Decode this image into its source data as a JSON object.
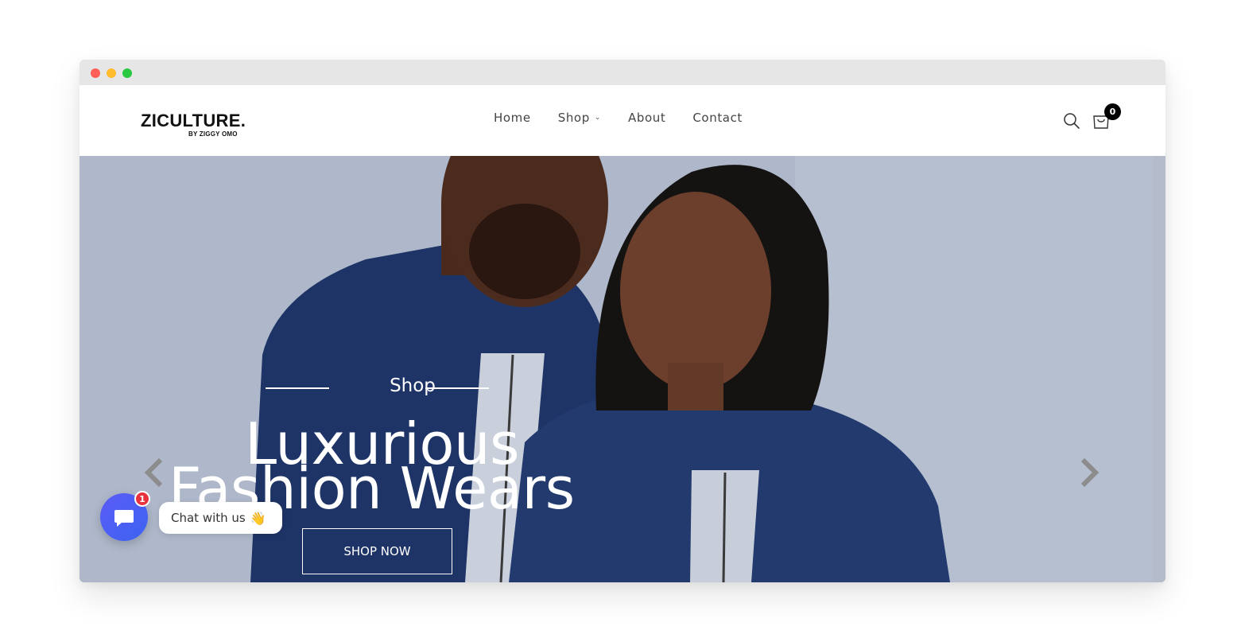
{
  "brand": {
    "name": "ZICULTURE.",
    "tagline": "BY ZIGGY OMO"
  },
  "nav": {
    "items": [
      {
        "label": "Home"
      },
      {
        "label": "Shop"
      },
      {
        "label": "About"
      },
      {
        "label": "Contact"
      }
    ]
  },
  "header": {
    "cart_count": "0",
    "search_icon": "search-icon",
    "cart_icon": "shopping-bag-icon"
  },
  "hero": {
    "eyebrow": "Shop",
    "headline_line1": "Luxurious",
    "headline_line2": "Fashion Wears",
    "cta_label": "SHOP NOW"
  },
  "chat": {
    "label": "Chat with us",
    "wave_emoji": "👋",
    "notification_count": "1",
    "accent": "#4f5ff5"
  },
  "colors": {
    "hero_bg": "#aab4c6",
    "garment_navy": "#1f3566",
    "badge_black": "#000000"
  }
}
